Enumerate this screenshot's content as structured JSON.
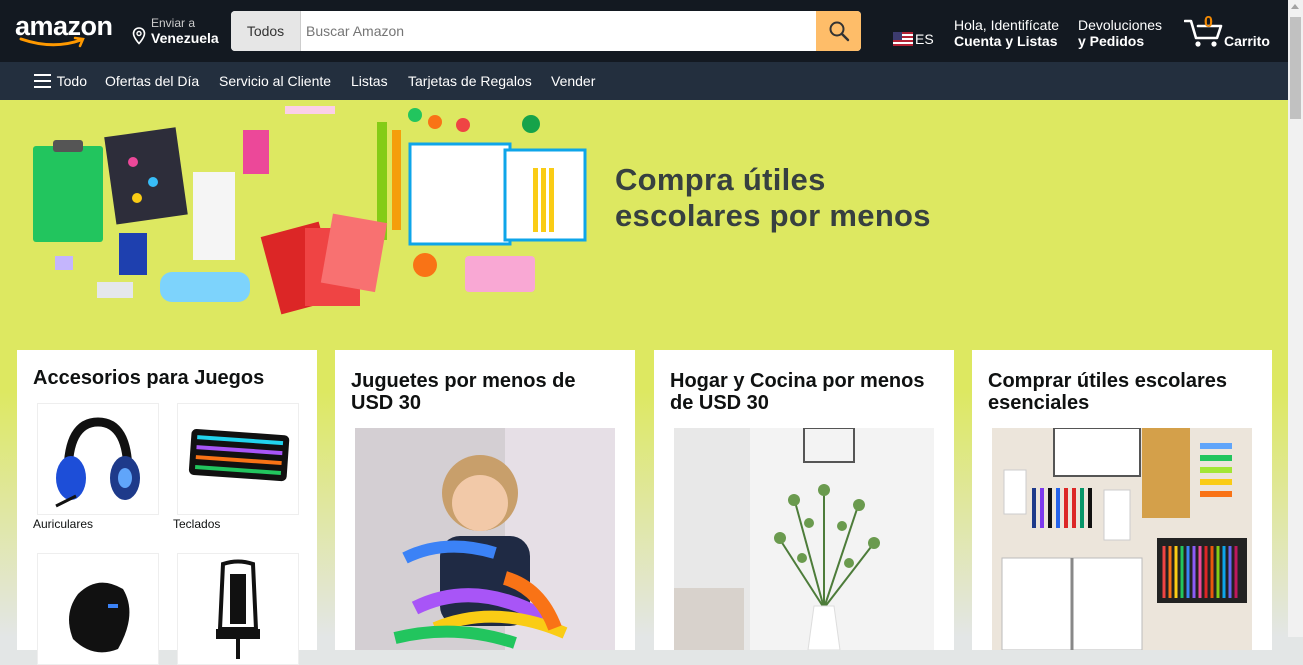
{
  "header": {
    "logo": "amazon",
    "deliver_line1": "Enviar a",
    "deliver_line2": "Venezuela",
    "search_category": "Todos",
    "search_placeholder": "Buscar Amazon",
    "language": "ES",
    "account_line1": "Hola, Identifícate",
    "account_line2": "Cuenta y Listas",
    "returns_line1": "Devoluciones",
    "returns_line2": "y Pedidos",
    "cart_count": "0",
    "cart_label": "Carrito"
  },
  "subnav": {
    "items": [
      "Todo",
      "Ofertas del Día",
      "Servicio al Cliente",
      "Listas",
      "Tarjetas de Regalos",
      "Vender"
    ]
  },
  "hero": {
    "line1": "Compra útiles",
    "line2": "escolares por menos"
  },
  "cards": [
    {
      "title": "Accesorios para Juegos",
      "tiles": [
        "Auriculares",
        "Teclados"
      ]
    },
    {
      "title": "Juguetes por menos de USD 30"
    },
    {
      "title": "Hogar y Cocina por menos de USD 30"
    },
    {
      "title": "Comprar útiles escolares esenciales"
    }
  ],
  "colors": {
    "nav_top": "#131921",
    "nav_sub": "#232f3e",
    "search_button": "#febd69",
    "cart_count": "#f08804",
    "hero_bg": "#dde861"
  }
}
